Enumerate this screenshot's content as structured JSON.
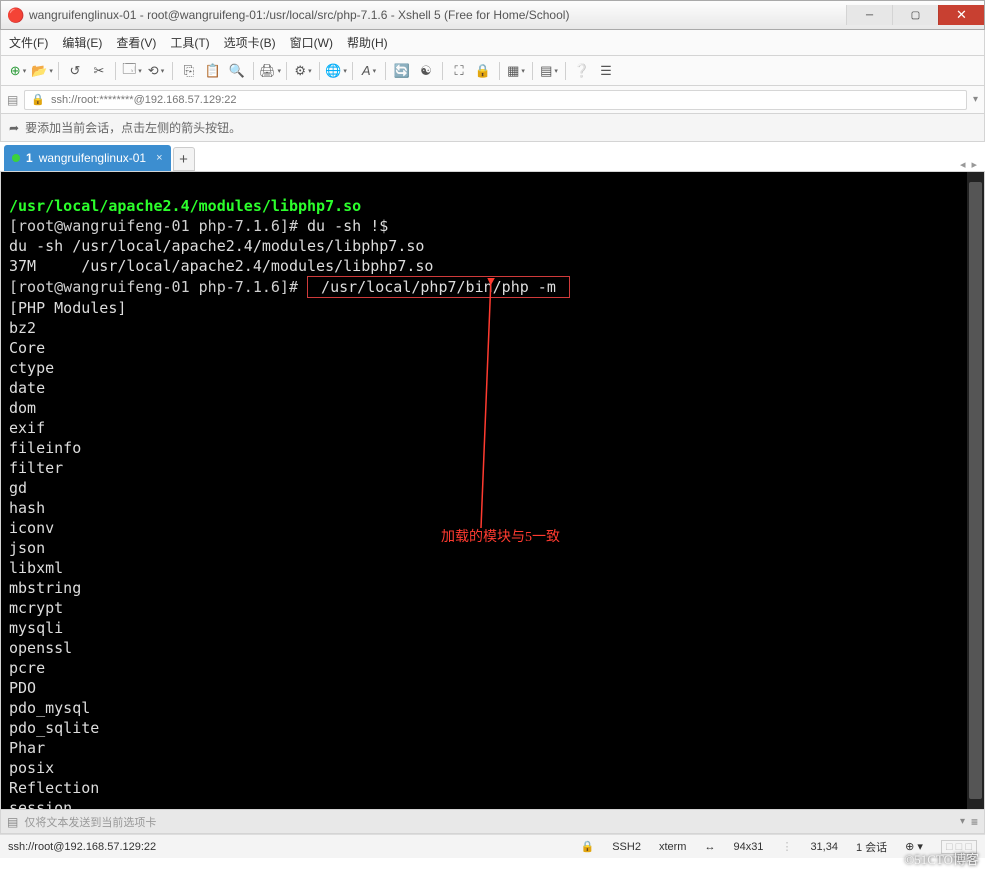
{
  "window": {
    "title": "wangruifenglinux-01 - root@wangruifeng-01:/usr/local/src/php-7.1.6 - Xshell 5 (Free for Home/School)"
  },
  "menu": {
    "items": [
      "文件(F)",
      "编辑(E)",
      "查看(V)",
      "工具(T)",
      "选项卡(B)",
      "窗口(W)",
      "帮助(H)"
    ]
  },
  "address": {
    "text": "ssh://root:********@192.168.57.129:22"
  },
  "hint": {
    "text": "要添加当前会话，点击左侧的箭头按钮。"
  },
  "tab": {
    "index": "1",
    "name": "wangruifenglinux-01"
  },
  "terminal": {
    "path_line": "/usr/local/apache2.4/modules/libphp7.so",
    "prompt1": "[root@wangruifeng-01 php-7.1.6]# ",
    "cmd1": "du -sh !$",
    "echo1": "du -sh /usr/local/apache2.4/modules/libphp7.so",
    "out1": "37M     /usr/local/apache2.4/modules/libphp7.so",
    "prompt2": "[root@wangruifeng-01 php-7.1.6]# ",
    "cmd2": " /usr/local/php7/bin/php -m ",
    "modules_header": "[PHP Modules]",
    "modules": [
      "bz2",
      "Core",
      "ctype",
      "date",
      "dom",
      "exif",
      "fileinfo",
      "filter",
      "gd",
      "hash",
      "iconv",
      "json",
      "libxml",
      "mbstring",
      "mcrypt",
      "mysqli",
      "openssl",
      "pcre",
      "PDO",
      "pdo_mysql",
      "pdo_sqlite",
      "Phar",
      "posix",
      "Reflection",
      "session"
    ],
    "annotation": "加载的模块与5一致"
  },
  "sendbar": {
    "placeholder": "仅将文本发送到当前选项卡"
  },
  "status": {
    "conn": "ssh://root@192.168.57.129:22",
    "proto": "SSH2",
    "term": "xterm",
    "size": "94x31",
    "pos": "31,34",
    "sessions": "1 会话"
  },
  "watermark": "©51CTO博客"
}
